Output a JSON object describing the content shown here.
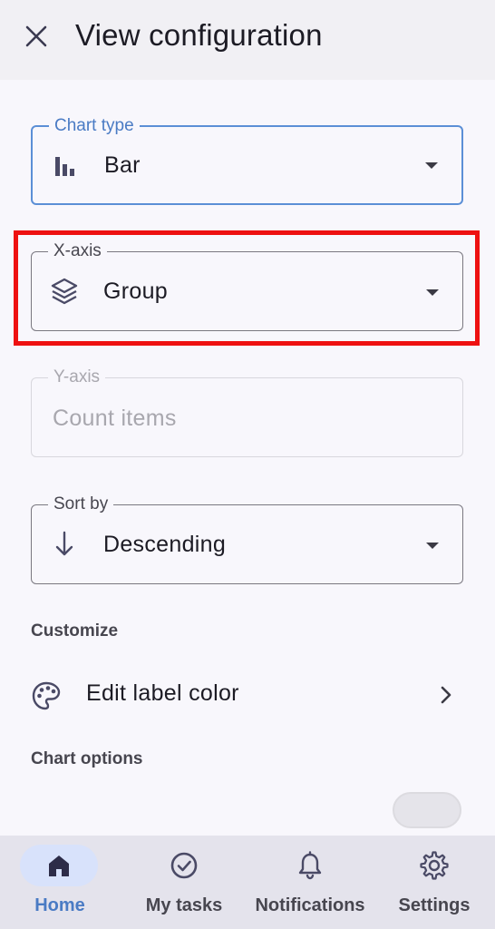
{
  "header": {
    "title": "View configuration",
    "close_icon": "close-icon"
  },
  "chart_type": {
    "label": "Chart type",
    "value": "Bar",
    "icon": "bar-chart-icon"
  },
  "x_axis": {
    "label": "X-axis",
    "value": "Group",
    "icon": "layers-icon",
    "highlight_color": "#ee1111"
  },
  "y_axis": {
    "label": "Y-axis",
    "placeholder": "Count items",
    "disabled": true
  },
  "sort_by": {
    "label": "Sort by",
    "value": "Descending",
    "icon": "arrow-down-icon"
  },
  "customize": {
    "section_label": "Customize",
    "edit_label_color": "Edit label color",
    "icon": "palette-icon"
  },
  "chart_options": {
    "section_label": "Chart options"
  },
  "nav": {
    "items": [
      {
        "label": "Home",
        "icon": "home-icon",
        "active": true
      },
      {
        "label": "My tasks",
        "icon": "check-circle-icon"
      },
      {
        "label": "Notifications",
        "icon": "bell-icon"
      },
      {
        "label": "Settings",
        "icon": "gear-icon"
      }
    ]
  },
  "colors": {
    "accent": "#4a7bc4",
    "focused_border": "#5b8fd6",
    "active_nav_pill": "#d8e2fb",
    "background": "#f8f7fc",
    "header_bg": "#f1f0f4",
    "navbar_bg": "#e4e3ec"
  }
}
